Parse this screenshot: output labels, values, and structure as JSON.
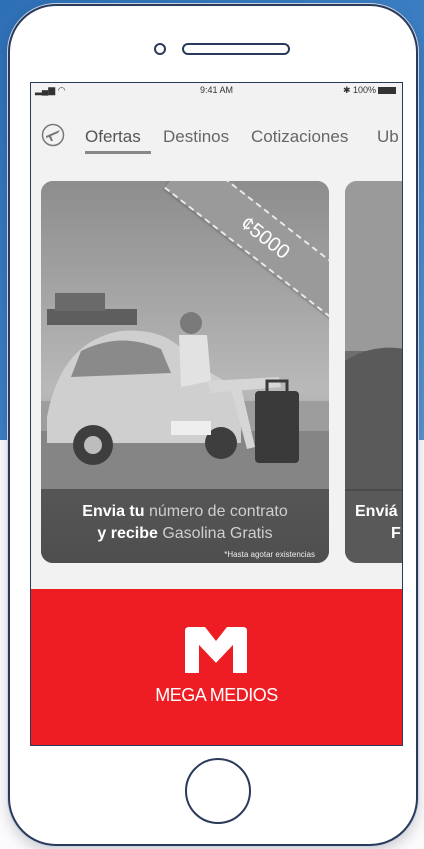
{
  "status_bar": {
    "signal": "▂▄▆ ◠",
    "time": "9:41 AM",
    "battery": "✱ 100%"
  },
  "nav": {
    "tabs": [
      {
        "label": "Ofertas",
        "active": true
      },
      {
        "label": "Destinos"
      },
      {
        "label": "Cotizaciones"
      },
      {
        "label": "Ub"
      }
    ]
  },
  "promo_card": {
    "ribbon": "¢5000",
    "caption_line1_a": "Envia tu ",
    "caption_line1_b": "número de contrato",
    "caption_line2_a": "y recibe ",
    "caption_line2_b": "Gasolina Gratis",
    "fineprint": "*Hasta agotar existencias"
  },
  "next_card": {
    "caption_line1": "Enviá",
    "caption_line2": "F"
  },
  "brand": {
    "name": "MEGA MEDIOS",
    "color": "#ee1d23"
  }
}
